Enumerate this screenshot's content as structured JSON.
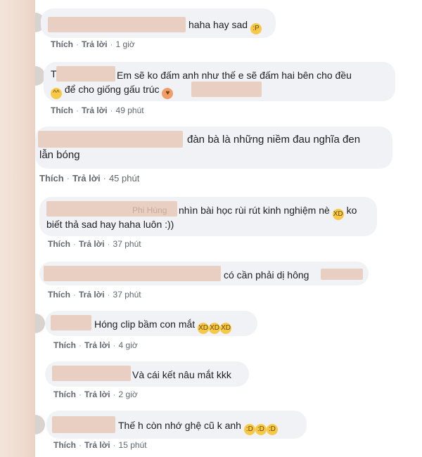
{
  "comments": [
    {
      "text": "haha hay sad",
      "action1": "Thích",
      "action2": "Trả lời",
      "time": "1 giờ"
    },
    {
      "text_line1": "Em sẽ ko đấm anh như thế e sẽ đấm hai bên cho đều",
      "text_line2": "để cho giống gấu trúc",
      "action1": "Thích",
      "action2": "Trả lời",
      "time": "49 phút"
    },
    {
      "text_line1": "đàn bà là những niềm đau nghĩa đen",
      "text_line2": "lẫn bóng",
      "action1": "Thích",
      "action2": "Trả lời",
      "time": "45 phút"
    },
    {
      "name_partial": "Phi Hùng",
      "text_line1": "nhìn bài học rùi rút kinh nghiệm nè",
      "text_line1_tail": "ko",
      "text_line2": "biết thả sad hay haha luôn :))",
      "action1": "Thích",
      "action2": "Trả lời",
      "time": "37 phút"
    },
    {
      "text": "có cần phải dị hông",
      "action1": "Thích",
      "action2": "Trả lời",
      "time": "37 phút"
    },
    {
      "text": "Hóng clip bầm con mắt",
      "action1": "Thích",
      "action2": "Trả lời",
      "time": "4 giờ"
    },
    {
      "text": "Và cái kết nâu mắt kkk",
      "action1": "Thích",
      "action2": "Trả lời",
      "time": "2 giờ"
    },
    {
      "text": "Thế h còn nhớ ghệ cũ k anh",
      "action1": "Thích",
      "action2": "Trả lời",
      "time": "15 phút"
    }
  ],
  "colors": {
    "bubble": "#f0f2f5",
    "blur": "#e9cfc1",
    "meta": "#606770"
  },
  "icons": [
    "emoji-tongue-icon",
    "emoji-grin-icon",
    "emoji-love-icon",
    "emoji-laugh-cry-icon",
    "emoji-smile-icon"
  ]
}
